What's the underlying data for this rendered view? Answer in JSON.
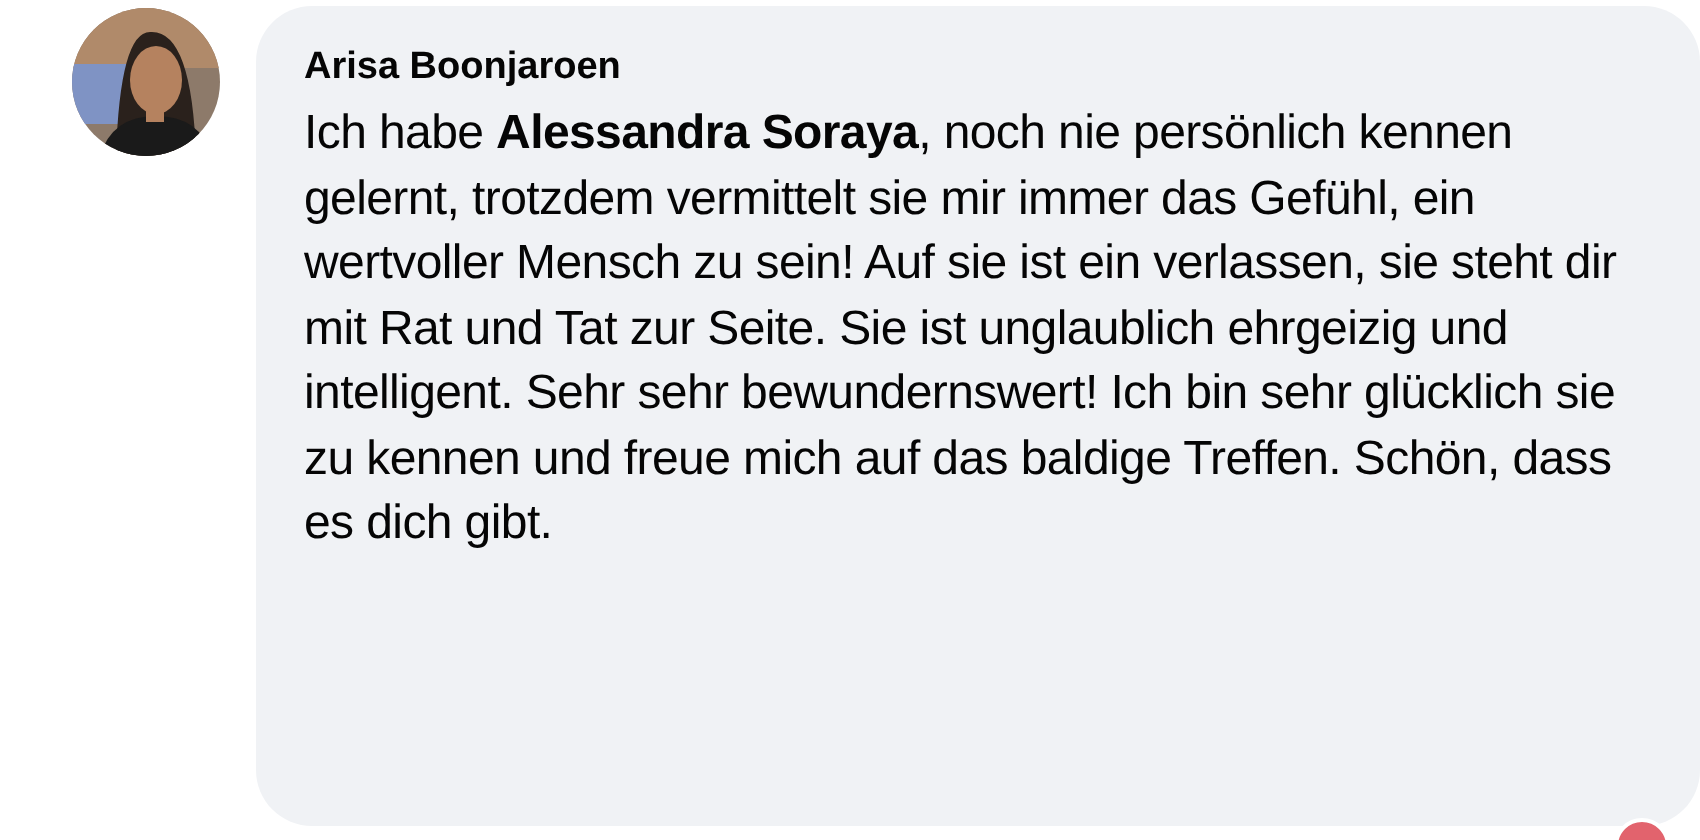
{
  "comment": {
    "author": "Arisa Boonjaroen",
    "text": "Ich habe **Alessandra Soraya**, noch nie persönlich kennen gelernt, trotzdem vermittelt sie mir immer das Gefühl, ein wertvoller Mensch zu sein! Auf sie ist ein verlassen, sie steht dir mit Rat und Tat zur Seite. Sie ist unglaublich ehrgeizig und intelligent. Sehr sehr bewundernswert! Ich bin sehr glücklich sie zu kennen und freue mich auf das baldige Treffen. Schön, dass es dich gibt."
  }
}
